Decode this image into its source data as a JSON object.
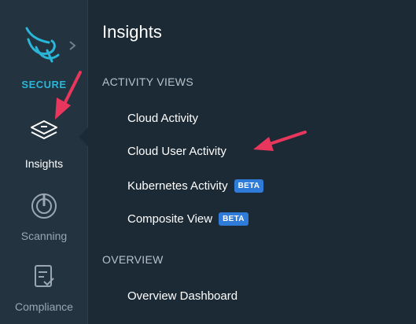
{
  "rail": {
    "brand_label": "SECURE",
    "items": [
      {
        "label": "Insights",
        "icon": "layers-icon",
        "active": true
      },
      {
        "label": "Scanning",
        "icon": "scanning-icon",
        "active": false
      },
      {
        "label": "Compliance",
        "icon": "compliance-icon",
        "active": false
      }
    ]
  },
  "panel": {
    "title": "Insights",
    "sections": [
      {
        "header": "ACTIVITY VIEWS",
        "items": [
          {
            "label": "Cloud Activity"
          },
          {
            "label": "Cloud User Activity"
          },
          {
            "label": "Kubernetes Activity",
            "badge": "BETA"
          },
          {
            "label": "Composite View",
            "badge": "BETA"
          }
        ]
      },
      {
        "header": "OVERVIEW",
        "items": [
          {
            "label": "Overview Dashboard"
          }
        ]
      }
    ]
  },
  "colors": {
    "background": "#1c2a35",
    "rail": "#23333f",
    "brand": "#29b6d8",
    "badge": "#2f7bd9",
    "annotation": "#e8365d"
  }
}
